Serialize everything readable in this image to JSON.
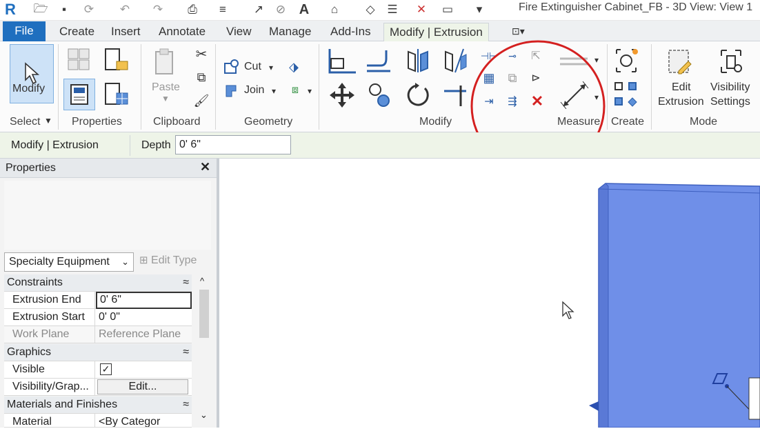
{
  "window": {
    "title": "Fire Extinguisher Cabinet_FB - 3D View: View 1"
  },
  "tabs": [
    {
      "label": "File"
    },
    {
      "label": "Create"
    },
    {
      "label": "Insert"
    },
    {
      "label": "Annotate"
    },
    {
      "label": "View"
    },
    {
      "label": "Manage"
    },
    {
      "label": "Add-Ins"
    },
    {
      "label": "Modify | Extrusion"
    }
  ],
  "ribbon": {
    "modify_label": "Modify",
    "select_label": "Select",
    "properties_label": "Properties",
    "clipboard": {
      "paste": "Paste",
      "title": "Clipboard"
    },
    "geometry": {
      "cut": "Cut",
      "join": "Join",
      "title": "Geometry"
    },
    "modify_title": "Modify",
    "measure_title": "Measure",
    "create_title": "Create",
    "mode": {
      "edit_extrusion_1": "Edit",
      "edit_extrusion_2": "Extrusion",
      "visibility_1": "Visibility",
      "visibility_2": "Settings",
      "title": "Mode"
    }
  },
  "options_bar": {
    "context": "Modify | Extrusion",
    "depth_label": "Depth",
    "depth_value": "0'  6\""
  },
  "properties": {
    "title": "Properties",
    "type_selector": "Specialty Equipment",
    "edit_type": "Edit Type",
    "groups": {
      "constraints": "Constraints",
      "graphics": "Graphics",
      "materials": "Materials and Finishes"
    },
    "rows": {
      "extrusion_end": {
        "name": "Extrusion End",
        "value": "0'  6\""
      },
      "extrusion_start": {
        "name": "Extrusion Start",
        "value": "0'  0\""
      },
      "work_plane": {
        "name": "Work Plane",
        "value": "Reference Plane"
      },
      "visible": {
        "name": "Visible"
      },
      "visibility_graphics": {
        "name": "Visibility/Grap...",
        "value": "Edit..."
      },
      "material": {
        "name": "Material",
        "value": "<By Categor"
      }
    }
  },
  "colors": {
    "file_tab": "#1f6fbf",
    "extrusion": "#6f8fe8",
    "annotation_circle": "#d42020"
  }
}
